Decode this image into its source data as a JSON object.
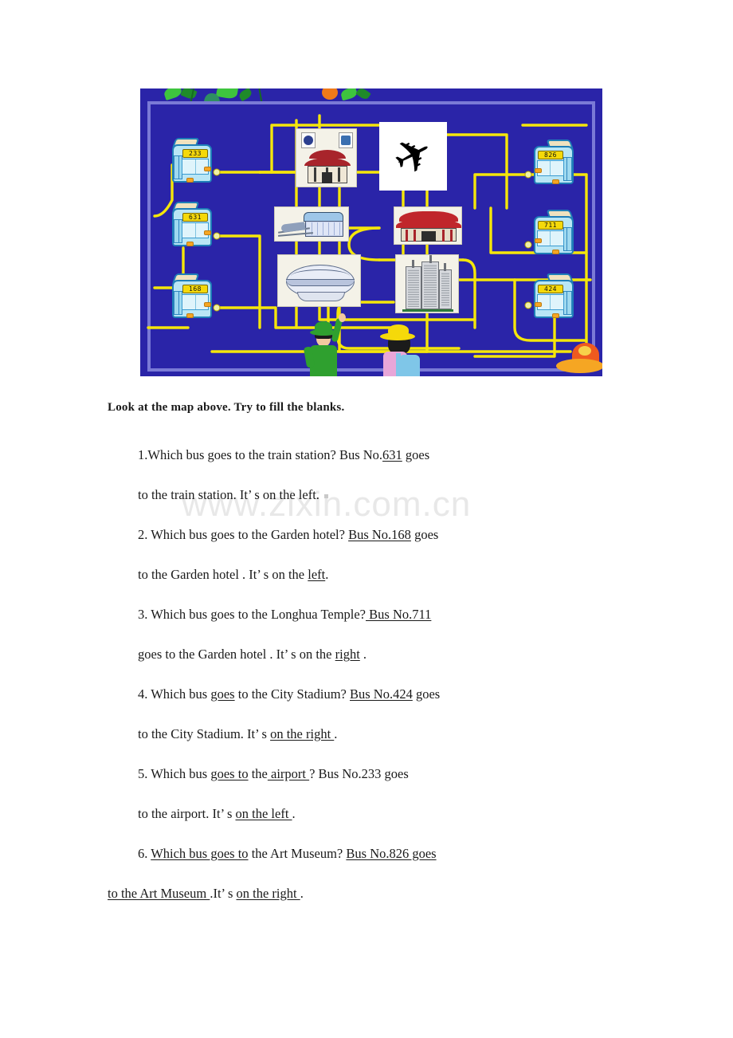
{
  "document": {
    "watermark": "www.zixin.com.cn",
    "instruction": "Look at the map above. Try to fill the blanks."
  },
  "map": {
    "alt": "City bus route map with six buses and six landmarks connected by yellow roads",
    "background_color": "#2a24a8",
    "road_color": "#f5e60a",
    "frame_color": "#7a7ad6",
    "buses_left": [
      {
        "number": "233",
        "side": "left"
      },
      {
        "number": "631",
        "side": "left"
      },
      {
        "number": "168",
        "side": "left"
      }
    ],
    "buses_right": [
      {
        "number": "826",
        "side": "right"
      },
      {
        "number": "711",
        "side": "right"
      },
      {
        "number": "424",
        "side": "right"
      }
    ],
    "landmarks": [
      {
        "name": "art-museum",
        "label": "Art Museum",
        "icon": "pagoda-with-signs"
      },
      {
        "name": "airport",
        "label": "airport",
        "icon": "airplane-icon"
      },
      {
        "name": "train-station",
        "label": "train station",
        "icon": "station-building"
      },
      {
        "name": "longhua-temple",
        "label": "Longhua Temple",
        "icon": "red-temple"
      },
      {
        "name": "city-stadium",
        "label": "City Stadium",
        "icon": "dome-stadium"
      },
      {
        "name": "garden-hotel",
        "label": "Garden hotel",
        "icon": "tower-buildings"
      }
    ],
    "people": [
      {
        "name": "boy-pointing",
        "hat_color": "#2fa02f",
        "coat_color": "#2fa02f"
      },
      {
        "name": "girl-looking",
        "hat_color": "#f5d90a",
        "coat_color": "#e8a6d8"
      }
    ]
  },
  "exercises": [
    {
      "number": "1.",
      "line1_pre": "Which bus goes to the train station? Bus No.",
      "line1_blank": "631",
      "line1_post": " goes",
      "line2_pre": "to the train station. It",
      "line2_apos": "’",
      "line2_mid": "  s on the left.",
      "line2_blank": "",
      "line2_post": ""
    },
    {
      "number": "2.",
      "line1_pre": " Which bus goes to the Garden hotel? ",
      "line1_blank": "Bus No.168",
      "line1_post": " goes",
      "line2_pre": "to the Garden hotel . It",
      "line2_apos": "’",
      "line2_mid": "  s on the ",
      "line2_blank": "left",
      "line2_post": "."
    },
    {
      "number": "3.",
      "line1_pre": " Which bus goes to the Longhua Temple?",
      "line1_blank": " Bus No.711",
      "line1_post": "",
      "line2_pre": "goes to the Garden hotel . It",
      "line2_apos": "’",
      "line2_mid": "  s on the ",
      "line2_blank": "right",
      "line2_post": " ."
    },
    {
      "number": "4.",
      "line1_pre": " Which bus ",
      "line1_blank": "goes",
      "line1_post": " to the City Stadium? ",
      "line1_blank2": "Bus No.424",
      "line1_post2": " goes",
      "line2_pre": "to the City Stadium. It",
      "line2_apos": "’",
      "line2_mid": "  s ",
      "line2_blank": "on the right ",
      "line2_post": "."
    },
    {
      "number": "5.",
      "line1_pre": " Which bus ",
      "line1_blank": "goes to",
      "line1_post": " the",
      "line1_blank2": " airport ",
      "line1_post2": "? Bus No.233 goes",
      "line2_pre": "to the airport. It",
      "line2_apos": "’",
      "line2_mid": "  s ",
      "line2_blank": "on the left ",
      "line2_post": "."
    },
    {
      "number": "6.",
      "line1_pre": " ",
      "line1_blank": "Which bus goes to",
      "line1_post": " the Art Museum? ",
      "line1_blank2": "Bus No.826 goes",
      "line1_post2": "",
      "line2_blank": "to the Art Museum ",
      "line2_mid_pre": ".It",
      "line2_apos": "’",
      "line2_mid": "  s ",
      "line2_blank2": "on the right ",
      "line2_post": "."
    }
  ]
}
